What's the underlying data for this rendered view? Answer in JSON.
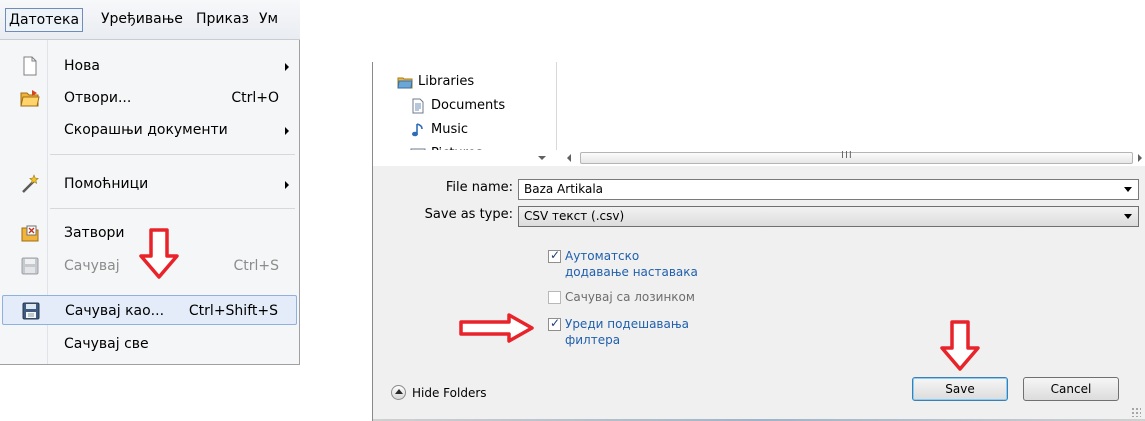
{
  "menubar": {
    "items": [
      {
        "label": "Датотека"
      },
      {
        "label": "Уређивање"
      },
      {
        "label": "Приказ"
      },
      {
        "label": "Ум"
      }
    ]
  },
  "file_menu": {
    "items": [
      {
        "label": "Нова",
        "shortcut": "",
        "submenu": true
      },
      {
        "label": "Отвори...",
        "shortcut": "Ctrl+O",
        "submenu": false
      },
      {
        "label": "Скорашњи документи",
        "shortcut": "",
        "submenu": true
      },
      {
        "label": "Помоћници",
        "shortcut": "",
        "submenu": true
      },
      {
        "label": "Затвори",
        "shortcut": "",
        "submenu": false
      },
      {
        "label": "Сачувај",
        "shortcut": "Ctrl+S",
        "submenu": false,
        "disabled": true
      },
      {
        "label": "Сачувај као...",
        "shortcut": "Ctrl+Shift+S",
        "submenu": false,
        "highlighted": true
      },
      {
        "label": "Сачувај све",
        "shortcut": "",
        "submenu": false
      }
    ]
  },
  "dialog": {
    "tree": [
      {
        "label": "Libraries",
        "icon": "libraries-icon"
      },
      {
        "label": "Documents",
        "icon": "documents-icon"
      },
      {
        "label": "Music",
        "icon": "music-icon"
      },
      {
        "label": "Pictures",
        "icon": "pictures-icon"
      }
    ],
    "scroll_grip": "III",
    "file_name_label": "File name:",
    "file_name_value": "Baza Artikala",
    "save_type_label": "Save as type:",
    "save_type_value": "CSV текст (.csv)",
    "options": [
      {
        "label_line1": "Аутоматско",
        "label_line2": "додавање наставака",
        "checked": true
      },
      {
        "label_line1": "Сачувај са лозинком",
        "label_line2": "",
        "checked": false
      },
      {
        "label_line1": "Уреди подешавања",
        "label_line2": "филтера",
        "checked": true
      }
    ],
    "hide_folders": "Hide Folders",
    "save_button": "Save",
    "cancel_button": "Cancel"
  },
  "colors": {
    "annotation_arrow": "#e8232a",
    "option_text": "#1f5fad",
    "highlight": "#e3ecf8"
  }
}
